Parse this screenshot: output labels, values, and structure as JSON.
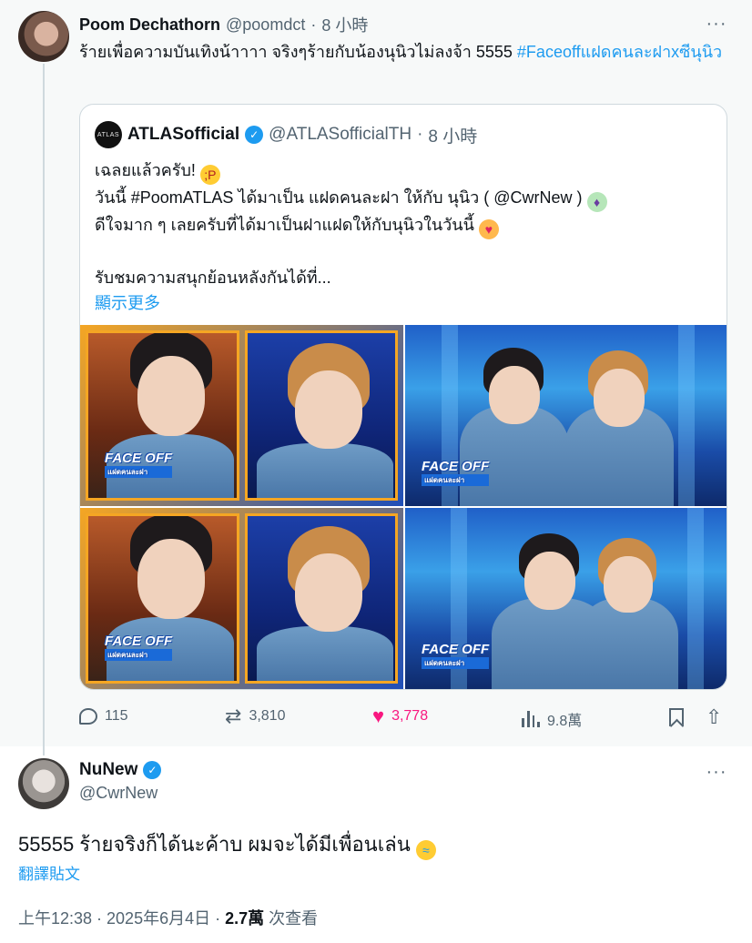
{
  "main_tweet": {
    "display_name": "Poom Dechathorn",
    "handle": "@poomdct",
    "separator": "·",
    "time": "8 小時",
    "text": "ร้ายเพื่อความบันเทิงน้าาาา จริงๆร้ายกับน้องนุนิวไม่ลงจ้า 5555 ",
    "hashtag": "#Faceoffแฝดคนละฝาxซีนุนิว",
    "more_icon": "more-horizontal-icon"
  },
  "quote": {
    "avatar_text": "ATLAS",
    "display_name": "ATLASofficial",
    "handle": "@ATLASofficialTH",
    "separator": "·",
    "time": "8 小時",
    "verified_icon": "verified-badge-icon",
    "lines": {
      "line1": "เฉลยแล้วครับ! ",
      "line2": "วันนี้ #PoomATLAS ได้มาเป็น แฝดคนละฝา ให้กับ นุนิว ( @CwrNew ) ",
      "line3": "ดีใจมาก ๆ เลยครับที่ได้มาเป็นฝาแฝดให้กับนุนิวในวันนี้ ",
      "line5": "รับชมความสนุกย้อนหลังกันได้ที่..."
    },
    "show_more": "顯示更多",
    "media": {
      "logo_text": "FACE OFF",
      "logo_sub": "แฝดคนละฝา"
    }
  },
  "actions": {
    "replies": "115",
    "retweets": "3,810",
    "likes": "3,778",
    "views": "9.8萬",
    "colors": {
      "like": "#f91880",
      "muted": "#536471",
      "link": "#1d9bf0"
    }
  },
  "reply": {
    "display_name": "NuNew",
    "handle": "@CwrNew",
    "text": "55555 ร้ายจริงก็ได้นะค้าบ ผมจะได้มีเพื่อนเล่น ",
    "translate": "翻譯貼文",
    "time": "上午12:38 · 2025年6月4日 · ",
    "views_count": "2.7萬",
    "views_label": " 次查看"
  }
}
